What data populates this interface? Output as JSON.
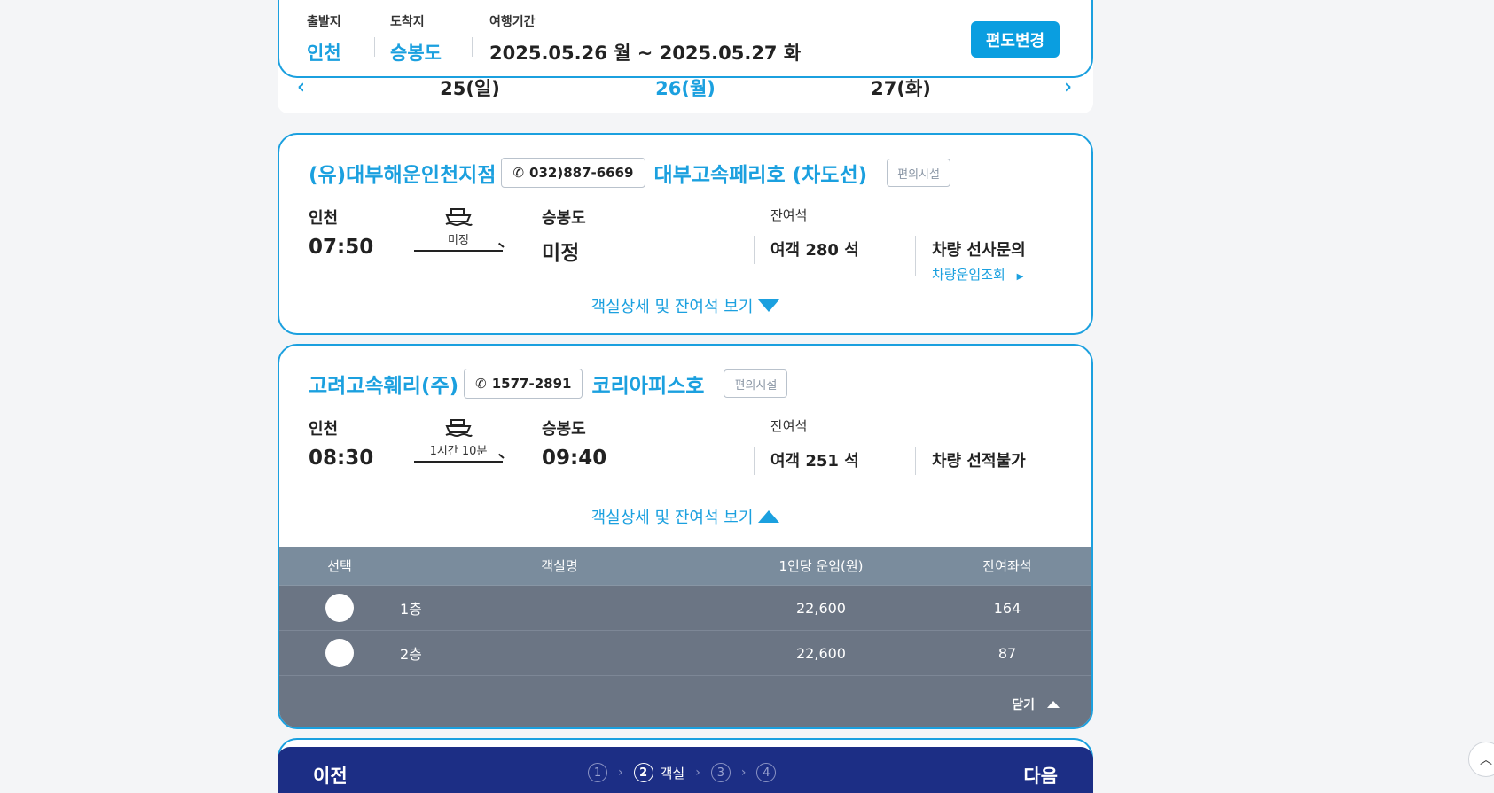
{
  "search": {
    "departure_label": "출발지",
    "departure_value": "인천",
    "arrival_label": "도착지",
    "arrival_value": "승봉도",
    "period_label": "여행기간",
    "period_value": "2025.05.26 월 ~ 2025.05.27 화",
    "change_button": "편도변경"
  },
  "dates": [
    {
      "label": "25(일)",
      "active": false
    },
    {
      "label": "26(월)",
      "active": true
    },
    {
      "label": "27(화)",
      "active": false
    }
  ],
  "trips": [
    {
      "company": "(유)대부해운인천지점",
      "phone": "032)887-6669",
      "ship": "대부고속페리호 (차도선)",
      "facility": "편의시설",
      "from": "인천",
      "depart_time": "07:50",
      "duration": "미정",
      "to": "승봉도",
      "arrive_time": "미정",
      "seat_label": "잔여석",
      "passenger": "여객 280 석",
      "vehicle": "차량 선사문의",
      "vehicle_link": "차량운임조회",
      "detail_link": "객실상세 및 잔여석 보기"
    },
    {
      "company": "고려고속훼리(주)",
      "phone": "1577-2891",
      "ship": "코리아피스호",
      "facility": "편의시설",
      "from": "인천",
      "depart_time": "08:30",
      "duration": "1시간 10분",
      "to": "승봉도",
      "arrive_time": "09:40",
      "seat_label": "잔여석",
      "passenger": "여객 251 석",
      "vehicle": "차량 선적불가",
      "detail_link": "객실상세 및 잔여석 보기"
    }
  ],
  "cabin_table": {
    "headers": [
      "선택",
      "객실명",
      "1인당 운임(원)",
      "잔여좌석"
    ],
    "rows": [
      {
        "name": "1층",
        "fare": "22,600",
        "remaining": "164"
      },
      {
        "name": "2층",
        "fare": "22,600",
        "remaining": "87"
      }
    ],
    "close_label": "닫기"
  },
  "stepbar": {
    "prev": "이전",
    "next": "다음",
    "steps": [
      "①",
      "②",
      "③",
      "④"
    ],
    "active_label": "객실"
  },
  "colors": {
    "accent": "#1ba0df",
    "navy": "#1c2e85",
    "table_bg": "#6b7584"
  }
}
